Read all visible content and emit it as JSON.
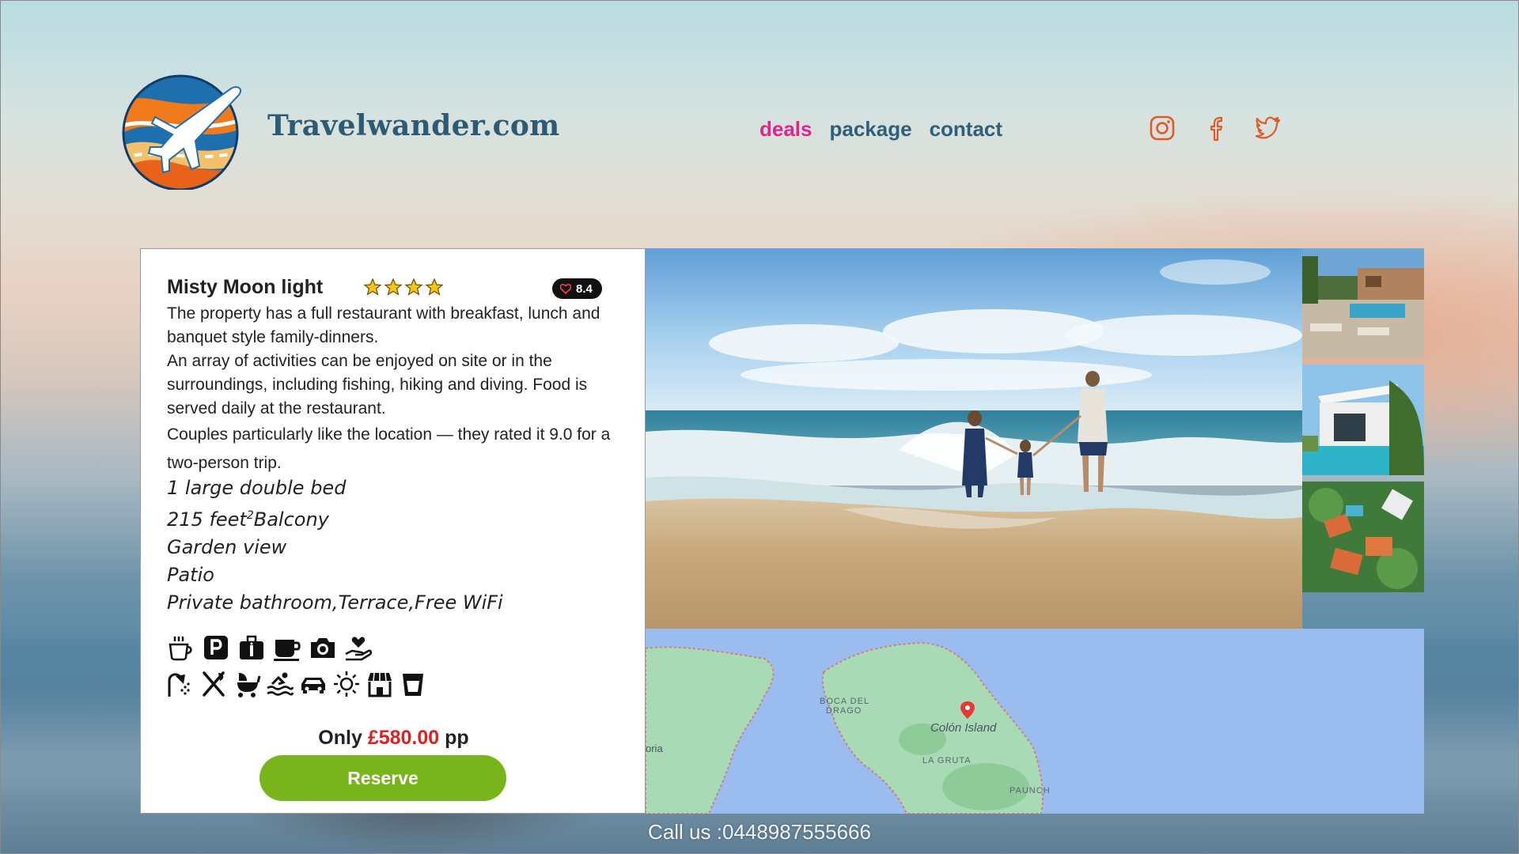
{
  "header": {
    "site_title": "Travelwander.com",
    "nav": [
      {
        "label": "deals",
        "active": true
      },
      {
        "label": "package",
        "active": false
      },
      {
        "label": "contact",
        "active": false
      }
    ],
    "social": [
      "instagram-icon",
      "facebook-icon",
      "twitter-icon"
    ]
  },
  "card": {
    "name": "Misty Moon light",
    "stars": 4,
    "rating": "8.4",
    "description": [
      "The property has a full restaurant with breakfast, lunch and banquet style family-dinners.",
      "An array of activities can be enjoyed on site or in the surroundings, including fishing, hiking and diving. Food is served daily at the restaurant.",
      "Couples particularly like the location — they rated it 9.0 for a two-person trip."
    ],
    "features": {
      "bed": "1 large double bed",
      "area_prefix": "215 feet",
      "area_sup": "2",
      "area_suffix": "Balcony",
      "view": "Garden view",
      "patio": "Patio",
      "extras": "Private bathroom,Terrace,Free WiFi"
    },
    "amenities_row1": [
      "tea-icon",
      "parking-icon",
      "luggage-icon",
      "coffee-cup-icon",
      "camera-icon",
      "hand-heart-icon"
    ],
    "amenities_row2": [
      "shower-icon",
      "restaurant-icon",
      "stroller-icon",
      "pool-icon",
      "car-icon",
      "sun-icon",
      "shop-icon",
      "drink-icon"
    ],
    "price": {
      "prefix": "Only ",
      "amount": "£580.00",
      "suffix": " pp"
    },
    "reserve_label": "Reserve"
  },
  "map": {
    "labels": [
      "BOCA DEL",
      "DRAGO",
      "Colón Island",
      "LA GRUTA",
      "PAUNCH",
      "oria"
    ]
  },
  "footer": {
    "call": "Call us :0448987555666"
  },
  "colors": {
    "accent": "#e0248f",
    "nav": "#2f5f7a",
    "reserve": "#79b41c",
    "price": "#e02020",
    "social": "#e05a26"
  }
}
